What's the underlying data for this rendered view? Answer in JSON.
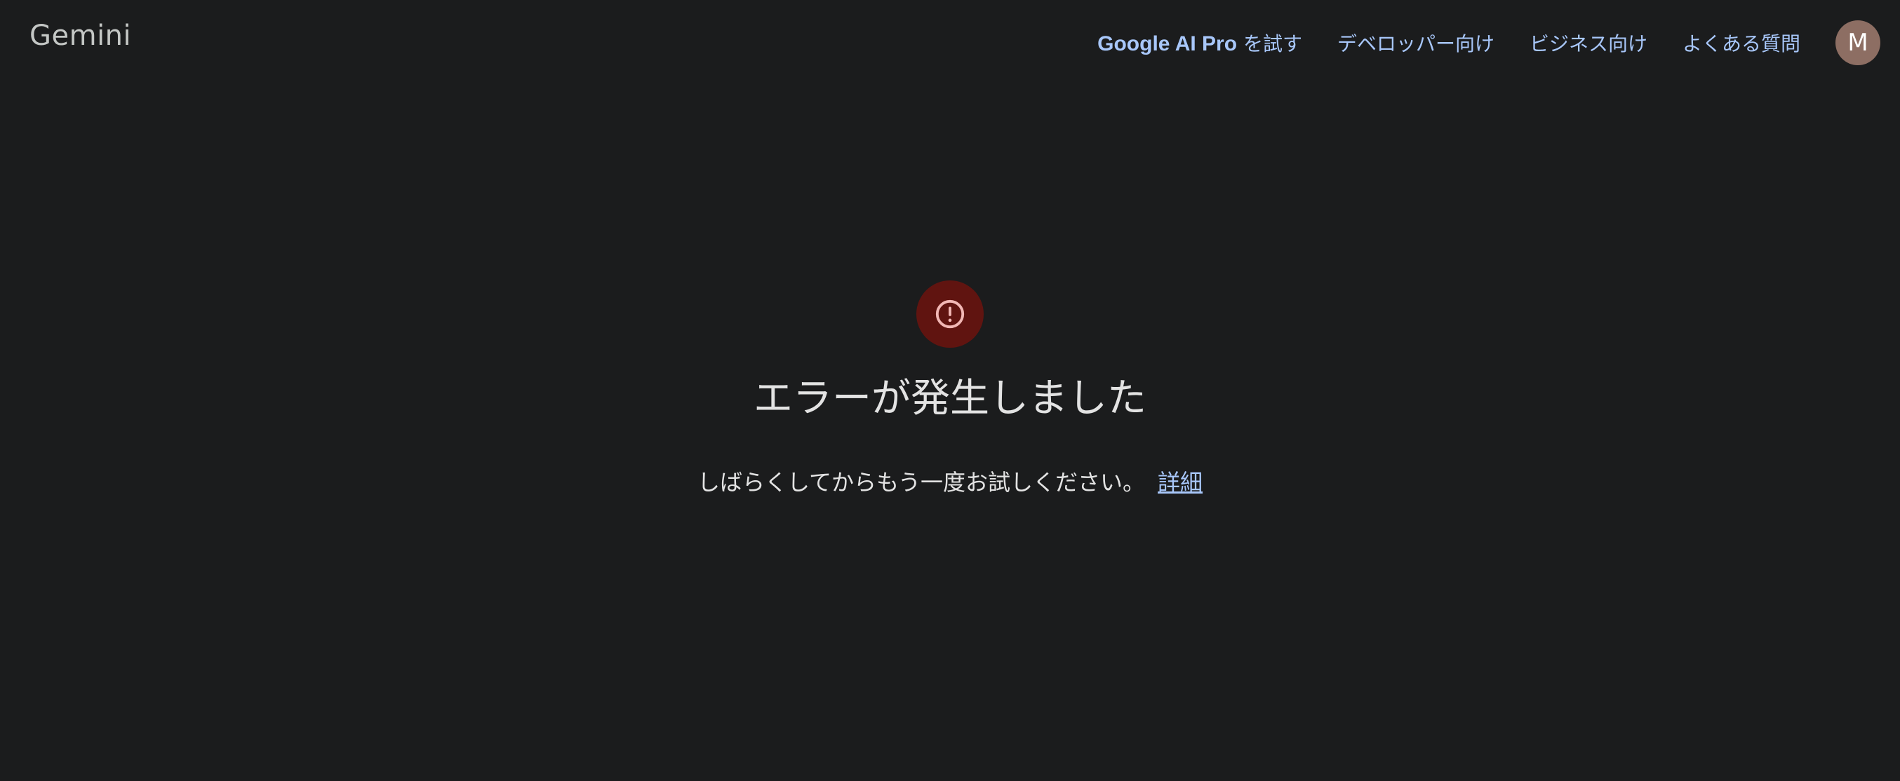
{
  "header": {
    "logo": "Gemini",
    "nav": {
      "pro_brand": "Google AI Pro",
      "pro_suffix": " を試す",
      "developers": "デベロッパー向け",
      "business": "ビジネス向け",
      "faq": "よくある質問"
    },
    "avatar_initial": "M"
  },
  "error": {
    "icon": "error-circle-icon",
    "title": "エラーが発生しました",
    "message": "しばらくしてからもう一度お試しください。",
    "details_link": "詳細"
  },
  "colors": {
    "background": "#1b1c1d",
    "link": "#a8c7fa",
    "error_badge": "#601410",
    "error_icon": "#f2b8b5",
    "avatar": "#8d6e63"
  }
}
